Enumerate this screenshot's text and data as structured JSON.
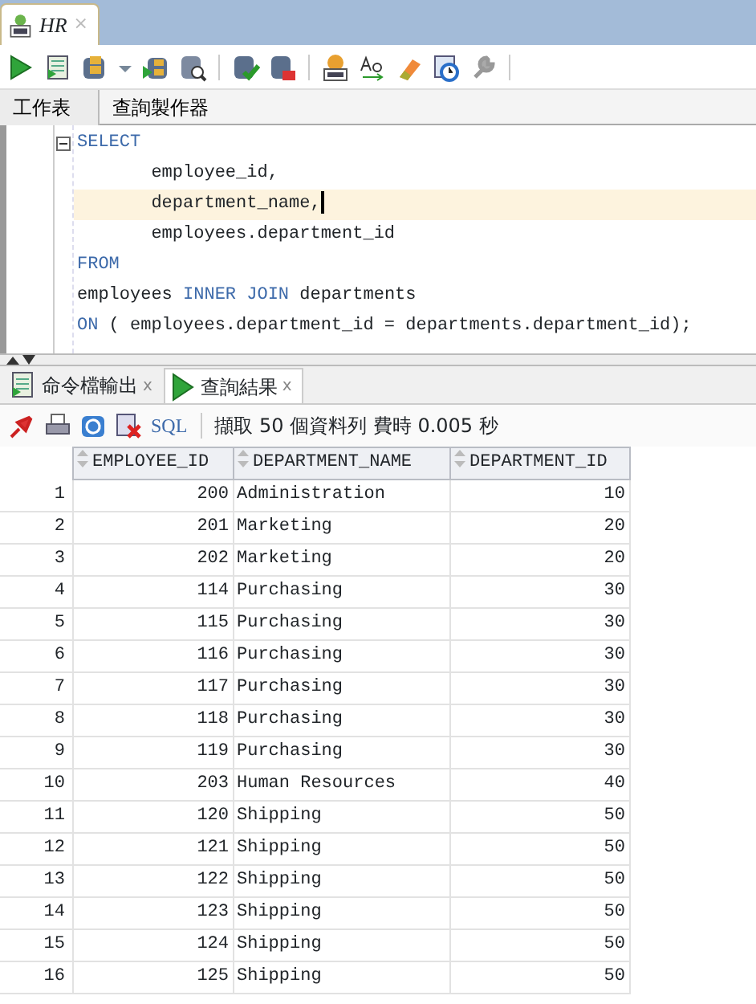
{
  "document_tab": {
    "title": "HR",
    "close": "×"
  },
  "editor_tabs": [
    {
      "label": "工作表",
      "selected": true
    },
    {
      "label": "查詢製作器",
      "selected": false
    }
  ],
  "code": [
    {
      "current": false,
      "tokens": [
        {
          "kind": "keyword",
          "text": "SELECT"
        }
      ]
    },
    {
      "current": false,
      "tokens": [
        {
          "kind": "plain",
          "text": "       employee_id,"
        }
      ]
    },
    {
      "current": true,
      "tokens": [
        {
          "kind": "plain",
          "text": "       department_name,"
        }
      ]
    },
    {
      "current": false,
      "tokens": [
        {
          "kind": "plain",
          "text": "       employees.department_id"
        }
      ]
    },
    {
      "current": false,
      "tokens": [
        {
          "kind": "keyword",
          "text": "FROM"
        }
      ]
    },
    {
      "current": false,
      "tokens": [
        {
          "kind": "plain",
          "text": "employees "
        },
        {
          "kind": "keyword",
          "text": "INNER JOIN"
        },
        {
          "kind": "plain",
          "text": " departments"
        }
      ]
    },
    {
      "current": false,
      "tokens": [
        {
          "kind": "keyword",
          "text": "ON"
        },
        {
          "kind": "plain",
          "text": " ( employees.department_id = departments.department_id);"
        }
      ]
    }
  ],
  "result_tabs": [
    {
      "label": "命令檔輸出",
      "close": "x",
      "selected": false,
      "kind": "script"
    },
    {
      "label": "查詢結果",
      "close": "x",
      "selected": true,
      "kind": "query"
    }
  ],
  "result_toolbar": {
    "sql": "SQL",
    "status": "擷取 50 個資料列 費時 0.005 秒"
  },
  "table": {
    "columns": [
      "EMPLOYEE_ID",
      "DEPARTMENT_NAME",
      "DEPARTMENT_ID"
    ],
    "rows": [
      {
        "number": "1",
        "cells": [
          "200",
          "Administration",
          "10"
        ]
      },
      {
        "number": "2",
        "cells": [
          "201",
          "Marketing",
          "20"
        ]
      },
      {
        "number": "3",
        "cells": [
          "202",
          "Marketing",
          "20"
        ]
      },
      {
        "number": "4",
        "cells": [
          "114",
          "Purchasing",
          "30"
        ]
      },
      {
        "number": "5",
        "cells": [
          "115",
          "Purchasing",
          "30"
        ]
      },
      {
        "number": "6",
        "cells": [
          "116",
          "Purchasing",
          "30"
        ]
      },
      {
        "number": "7",
        "cells": [
          "117",
          "Purchasing",
          "30"
        ]
      },
      {
        "number": "8",
        "cells": [
          "118",
          "Purchasing",
          "30"
        ]
      },
      {
        "number": "9",
        "cells": [
          "119",
          "Purchasing",
          "30"
        ]
      },
      {
        "number": "10",
        "cells": [
          "203",
          "Human Resources",
          "40"
        ]
      },
      {
        "number": "11",
        "cells": [
          "120",
          "Shipping",
          "50"
        ]
      },
      {
        "number": "12",
        "cells": [
          "121",
          "Shipping",
          "50"
        ]
      },
      {
        "number": "13",
        "cells": [
          "122",
          "Shipping",
          "50"
        ]
      },
      {
        "number": "14",
        "cells": [
          "123",
          "Shipping",
          "50"
        ]
      },
      {
        "number": "15",
        "cells": [
          "124",
          "Shipping",
          "50"
        ]
      },
      {
        "number": "16",
        "cells": [
          "125",
          "Shipping",
          "50"
        ]
      }
    ]
  }
}
